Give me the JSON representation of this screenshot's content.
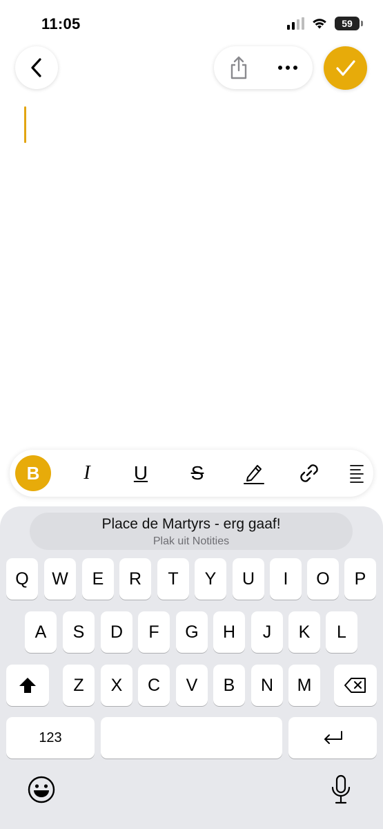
{
  "status_bar": {
    "time": "11:05",
    "battery": "59"
  },
  "toolbar": {
    "back_icon": "chevron-left-icon",
    "share_icon": "share-icon",
    "more_icon": "ellipsis-icon",
    "done_icon": "checkmark-icon"
  },
  "colors": {
    "accent": "#e7ab0a",
    "keyboard_bg": "#e7e8ec"
  },
  "format_bar": {
    "bold": "B",
    "italic": "I",
    "underline": "U",
    "strikethrough": "S",
    "highlight_icon": "pen-icon",
    "link_icon": "link-icon",
    "list_icon": "list-icon"
  },
  "paste_suggestion": {
    "text": "Place de Martyrs - erg gaaf!",
    "source": "Plak uit Notities"
  },
  "keyboard": {
    "row1": [
      "Q",
      "W",
      "E",
      "R",
      "T",
      "Y",
      "U",
      "I",
      "O",
      "P"
    ],
    "row2": [
      "A",
      "S",
      "D",
      "F",
      "G",
      "H",
      "J",
      "K",
      "L"
    ],
    "row3": [
      "Z",
      "X",
      "C",
      "V",
      "B",
      "N",
      "M"
    ],
    "numbers_key": "123"
  }
}
